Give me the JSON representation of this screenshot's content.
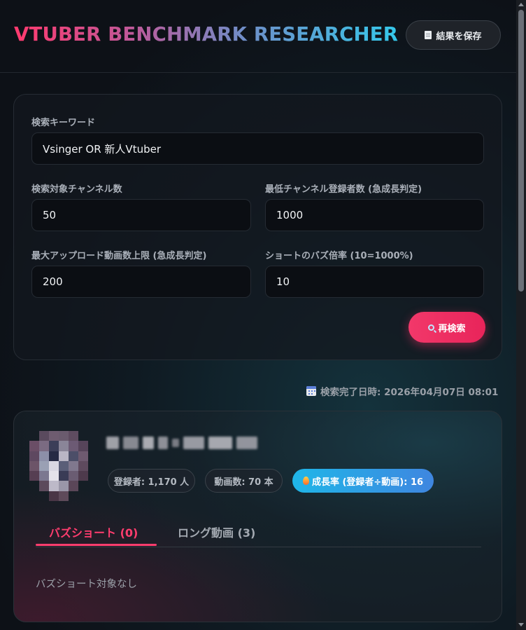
{
  "header": {
    "title": "VTUBER BENCHMARK RESEARCHER",
    "save_label": "結果を保存",
    "save_icon": "document-icon"
  },
  "search": {
    "keyword_label": "検索キーワード",
    "keyword_value": "Vsinger OR 新人Vtuber",
    "channels_label": "検索対象チャンネル数",
    "channels_value": "50",
    "min_subs_label": "最低チャンネル登録者数 (急成長判定)",
    "min_subs_value": "1000",
    "max_uploads_label": "最大アップロード動画数上限 (急成長判定)",
    "max_uploads_value": "200",
    "buzz_ratio_label": "ショートのバズ倍率 (10=1000%)",
    "buzz_ratio_value": "10",
    "research_label": "再検索",
    "research_icon": "magnifier-icon"
  },
  "completion": {
    "text": "検索完了日時: 2026年04月07日 08:01",
    "icon": "calendar-icon"
  },
  "channel": {
    "subscribers": "登録者: 1,170 人",
    "videos": "動画数: 70 本",
    "growth": "成長率 (登録者÷動画): 16",
    "growth_icon": "fire-icon",
    "tabs": [
      {
        "label": "バズショート (0)",
        "active": true
      },
      {
        "label": "ロング動画 (3)",
        "active": false
      }
    ],
    "empty_message": "バズショート対象なし"
  },
  "colors": {
    "accent": "#ff3d6e",
    "growth_badge": "#1fb6e8",
    "background": "#0d1117"
  }
}
